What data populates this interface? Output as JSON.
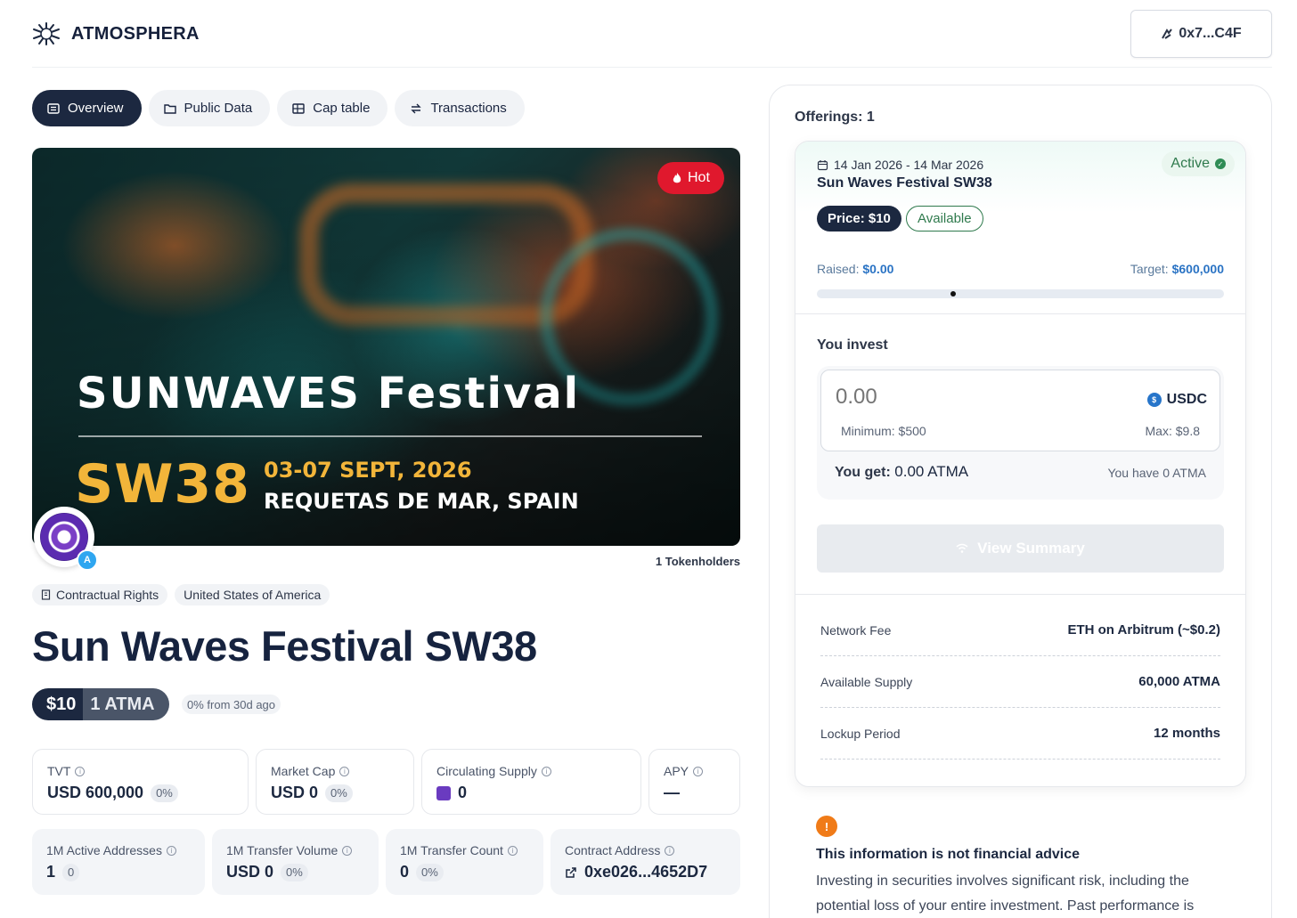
{
  "brand": {
    "name": "ATMOSPHERA",
    "logo_icon": "sun-rays-logo"
  },
  "wallet": {
    "address": "0x7...C4F",
    "icon": "wallet-icon"
  },
  "tabs": [
    {
      "label": "Overview",
      "icon": "list-icon",
      "active": true
    },
    {
      "label": "Public Data",
      "icon": "folder-icon",
      "active": false
    },
    {
      "label": "Cap table",
      "icon": "table-icon",
      "active": false
    },
    {
      "label": "Transactions",
      "icon": "transfer-icon",
      "active": false
    }
  ],
  "hero": {
    "badge": "Hot",
    "banner_title": "SUNWAVES Festival",
    "banner_code": "SW38",
    "banner_dates": "03-07 SEPT, 2026",
    "banner_location": "REQUETAS DE MAR, SPAIN"
  },
  "tokenholders": "1 Tokenholders",
  "tags": [
    "Contractual Rights",
    "United States of America"
  ],
  "asset": {
    "title": "Sun Waves Festival SW38",
    "price": "$10",
    "token_amount": "1 ATMA",
    "change": "0% from 30d ago"
  },
  "stats_row1": [
    {
      "label": "TVT",
      "value": "USD 600,000",
      "badge": "0%"
    },
    {
      "label": "Market Cap",
      "value": "USD 0",
      "badge": "0%"
    },
    {
      "label": "Circulating Supply",
      "value": "0",
      "badge": ""
    },
    {
      "label": "APY",
      "value": "—",
      "badge": ""
    }
  ],
  "stats_row2": [
    {
      "label": "1M Active Addresses",
      "value": "1",
      "badge": "0"
    },
    {
      "label": "1M Transfer Volume",
      "value": "USD 0",
      "badge": "0%"
    },
    {
      "label": "1M Transfer Count",
      "value": "0",
      "badge": "0%"
    },
    {
      "label": "Contract Address",
      "value": "0xe026...4652D7",
      "badge": ""
    }
  ],
  "offerings": {
    "label": "Offerings: 1",
    "card": {
      "dates": "14 Jan 2026 - 14 Mar 2026",
      "name": "Sun Waves Festival SW38",
      "status": "Active",
      "price_tag": "Price: $10",
      "availability": "Available",
      "raised_label": "Raised:",
      "raised_value": "$0.00",
      "target_label": "Target:",
      "target_value": "$600,000",
      "progress": 0
    }
  },
  "invest": {
    "label": "You invest",
    "placeholder": "0.00",
    "currency": "USDC",
    "minimum": "Minimum: $500",
    "maximum": "Max: $9.8",
    "you_get_label": "You get:",
    "you_get_value": "0.00 ATMA",
    "you_have": "You have 0 ATMA",
    "summary_button": "View Summary"
  },
  "details": [
    {
      "key": "Network Fee",
      "value": "ETH on Arbitrum (~$0.2)"
    },
    {
      "key": "Available Supply",
      "value": "60,000 ATMA"
    },
    {
      "key": "Lockup Period",
      "value": "12 months"
    }
  ],
  "disclaimer": {
    "title": "This information is not financial advice",
    "body": "Investing in securities involves significant risk, including the potential loss of your entire investment. Past performance is"
  },
  "colors": {
    "navy": "#1c2840",
    "hot": "#e0182d",
    "active_green": "#2f7a4d",
    "link_blue": "#2a73c4",
    "warning": "#f07b18"
  }
}
